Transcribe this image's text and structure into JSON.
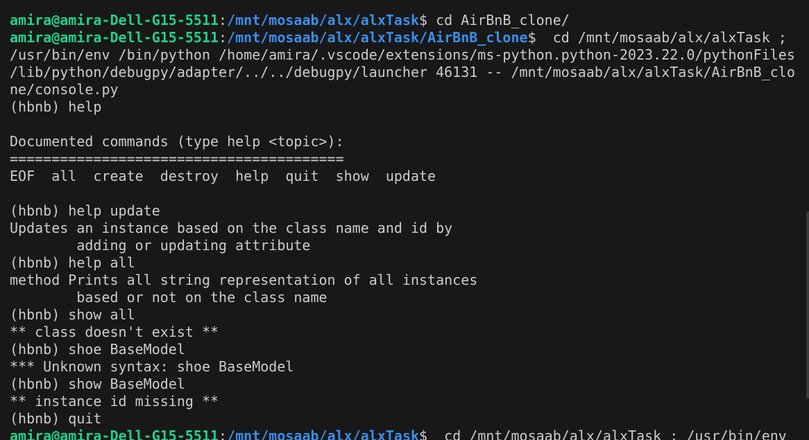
{
  "colors": {
    "background": "#181818",
    "text": "#cccccc",
    "prompt_user": "#23d18b",
    "prompt_path": "#3b8eea"
  },
  "prompt_user": "amira@amira-Dell-G15-5511",
  "lines": [
    {
      "type": "text",
      "text": "                 "
    },
    {
      "type": "prompt",
      "path": "/mnt/mosaab/alx/alxTask",
      "cmd": " cd AirBnB_clone/"
    },
    {
      "type": "prompt",
      "path": "/mnt/mosaab/alx/alxTask/AirBnB_clone",
      "cmd": "  cd /mnt/mosaab/alx/alxTask ;"
    },
    {
      "type": "text",
      "text": "/usr/bin/env /bin/python /home/amira/.vscode/extensions/ms-python.python-2023.22.0/pythonFiles"
    },
    {
      "type": "text",
      "text": "/lib/python/debugpy/adapter/../../debugpy/launcher 46131 -- /mnt/mosaab/alx/alxTask/AirBnB_clo"
    },
    {
      "type": "text",
      "text": "ne/console.py"
    },
    {
      "type": "text",
      "text": "(hbnb) help"
    },
    {
      "type": "text",
      "text": ""
    },
    {
      "type": "text",
      "text": "Documented commands (type help <topic>):"
    },
    {
      "type": "text",
      "text": "========================================"
    },
    {
      "type": "text",
      "text": "EOF  all  create  destroy  help  quit  show  update"
    },
    {
      "type": "text",
      "text": ""
    },
    {
      "type": "text",
      "text": "(hbnb) help update"
    },
    {
      "type": "text",
      "text": "Updates an instance based on the class name and id by"
    },
    {
      "type": "text",
      "text": "        adding or updating attribute"
    },
    {
      "type": "text",
      "text": "(hbnb) help all"
    },
    {
      "type": "text",
      "text": "method Prints all string representation of all instances"
    },
    {
      "type": "text",
      "text": "        based or not on the class name"
    },
    {
      "type": "text",
      "text": "(hbnb) show all"
    },
    {
      "type": "text",
      "text": "** class doesn't exist **"
    },
    {
      "type": "text",
      "text": "(hbnb) shoe BaseModel"
    },
    {
      "type": "text",
      "text": "*** Unknown syntax: shoe BaseModel"
    },
    {
      "type": "text",
      "text": "(hbnb) show BaseModel"
    },
    {
      "type": "text",
      "text": "** instance id missing **"
    },
    {
      "type": "text",
      "text": "(hbnb) quit"
    },
    {
      "type": "prompt",
      "path": "/mnt/mosaab/alx/alxTask",
      "cmd": "  cd /mnt/mosaab/alx/alxTask ; /usr/bin/env"
    }
  ]
}
